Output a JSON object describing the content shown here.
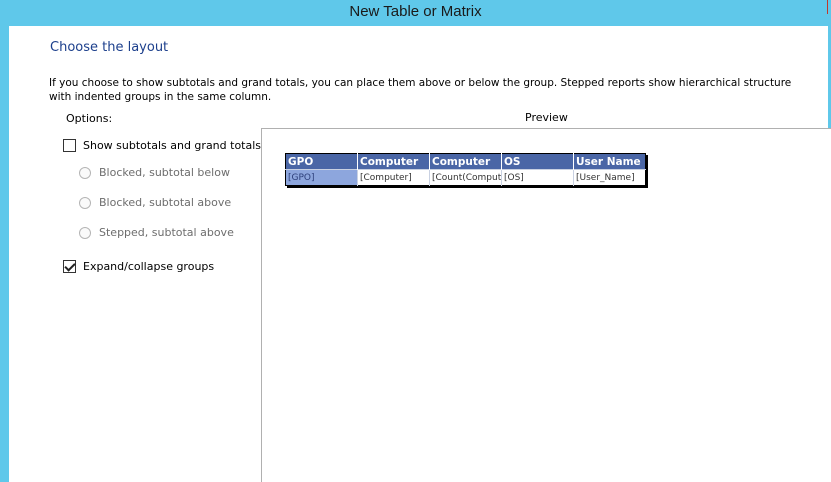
{
  "window": {
    "title": "New Table or Matrix"
  },
  "page": {
    "heading": "Choose the layout",
    "description": "If you choose to show subtotals and grand totals, you can place them above or below the group. Stepped reports show hierarchical structure with indented groups in the same column."
  },
  "options": {
    "label": "Options:",
    "show_subtotals": {
      "label": "Show subtotals and grand totals",
      "checked": false
    },
    "radios": [
      {
        "label": "Blocked, subtotal below",
        "selected": false,
        "enabled": false
      },
      {
        "label": "Blocked, subtotal above",
        "selected": false,
        "enabled": false
      },
      {
        "label": "Stepped, subtotal above",
        "selected": false,
        "enabled": false
      }
    ],
    "expand_collapse": {
      "label": "Expand/collapse groups",
      "checked": true
    }
  },
  "preview": {
    "label": "Preview",
    "headers": [
      "GPO",
      "Computer",
      "Computer",
      "OS",
      "User Name"
    ],
    "row": [
      "[GPO]",
      "[Computer]",
      "[Count(Computer)]",
      "[OS]",
      "[User_Name]"
    ]
  },
  "colors": {
    "title_bar": "#5fc8ea",
    "heading": "#1c3f8c",
    "table_header": "#4a66a6",
    "group_cell": "#8da6dd"
  }
}
